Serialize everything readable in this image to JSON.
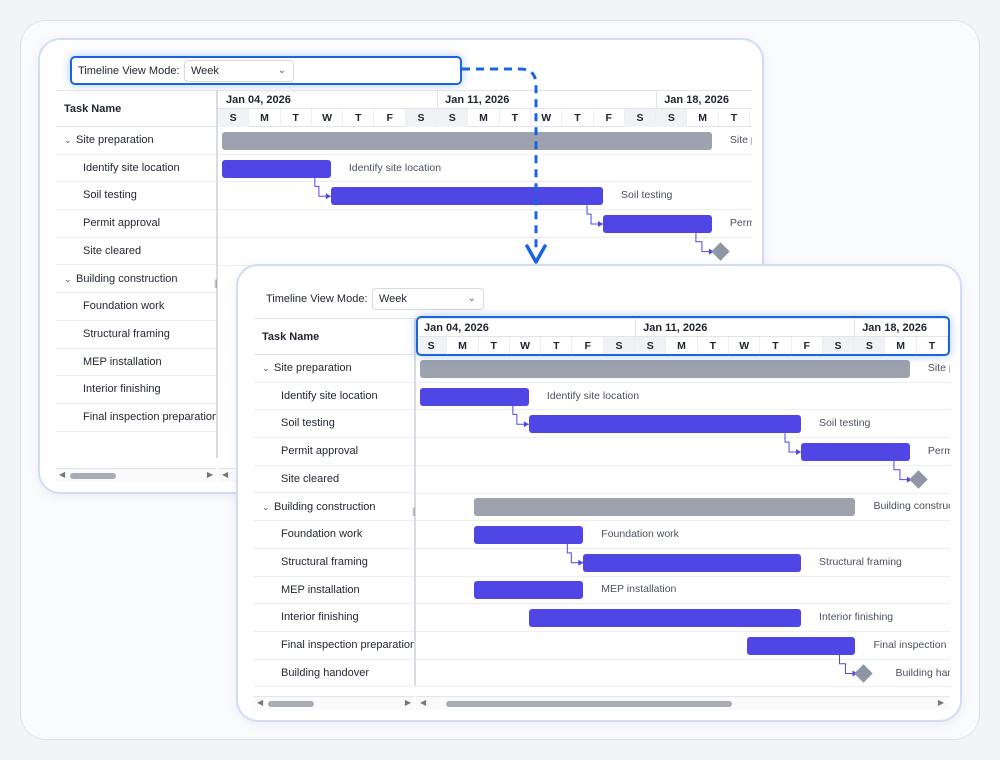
{
  "toolbar": {
    "label": "Timeline View Mode:",
    "mode": "Week",
    "chevron": "⌄"
  },
  "task_header": "Task Name",
  "weeks": [
    "Jan 04, 2026",
    "Jan 11, 2026",
    "Jan 18, 2026"
  ],
  "days": [
    "S",
    "M",
    "T",
    "W",
    "T",
    "F",
    "S",
    "S",
    "M",
    "T",
    "W",
    "T",
    "F",
    "S",
    "S",
    "M",
    "T"
  ],
  "collapse_icon": "⌄",
  "splitter_grip": "||",
  "scroll": {
    "left": "◀",
    "right": "▶"
  },
  "tasks": [
    {
      "name": "Site preparation",
      "summary": true
    },
    {
      "name": "Identify site location"
    },
    {
      "name": "Soil testing"
    },
    {
      "name": "Permit approval"
    },
    {
      "name": "Site cleared",
      "milestone": true
    },
    {
      "name": "Building construction",
      "summary": true
    },
    {
      "name": "Foundation work"
    },
    {
      "name": "Structural framing"
    },
    {
      "name": "MEP installation"
    },
    {
      "name": "Interior finishing"
    },
    {
      "name": "Final inspection preparation"
    },
    {
      "name": "Building handover",
      "milestone": true
    }
  ],
  "colors": {
    "task": "#4f46e5",
    "summary": "#9ca3af",
    "milestone": "#8e95a3",
    "focus": "#1a64e0"
  }
}
